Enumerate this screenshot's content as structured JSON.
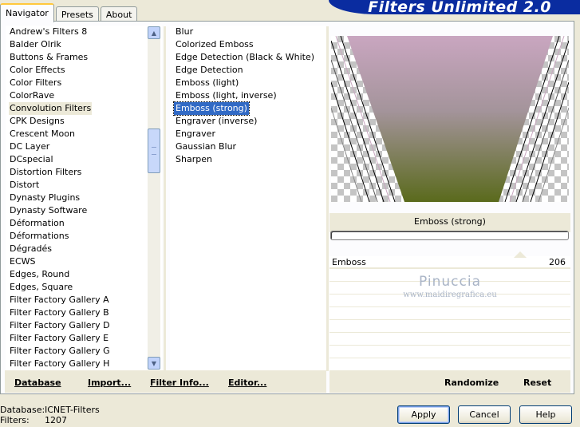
{
  "tabs": [
    "Navigator",
    "Presets",
    "About"
  ],
  "banner_title": "Filters Unlimited 2.0",
  "categories": [
    "Andrew's Filters 8",
    "Balder Olrik",
    "Buttons & Frames",
    "Color Effects",
    "Color Filters",
    "ColorRave",
    "Convolution Filters",
    "CPK Designs",
    "Crescent Moon",
    "DC Layer",
    "DCspecial",
    "Distortion Filters",
    "Distort",
    "Dynasty Plugins",
    "Dynasty Software",
    "Déformation",
    "Déformations",
    "Dégradés",
    "ECWS",
    "Edges, Round",
    "Edges, Square",
    "Filter Factory Gallery A",
    "Filter Factory Gallery B",
    "Filter Factory Gallery D",
    "Filter Factory Gallery E",
    "Filter Factory Gallery G",
    "Filter Factory Gallery H"
  ],
  "selected_category": "Convolution Filters",
  "filters": [
    "Blur",
    "Colorized Emboss",
    "Edge Detection (Black & White)",
    "Edge Detection",
    "Emboss (light)",
    "Emboss (light, inverse)",
    "Emboss (strong)",
    "Engraver (inverse)",
    "Engraver",
    "Gaussian Blur",
    "Sharpen"
  ],
  "selected_filter": "Emboss (strong)",
  "param": {
    "label": "Emboss",
    "value": "206",
    "fraction": 0.808
  },
  "watermark": {
    "name": "Pinuccia",
    "url": "www.maidiregrafica.eu"
  },
  "toolbar": {
    "database": "Database",
    "import": "Import...",
    "filter_info": "Filter Info...",
    "editor": "Editor...",
    "randomize": "Randomize",
    "reset": "Reset"
  },
  "status": {
    "database_label": "Database:",
    "database_value": "ICNET-Filters",
    "filters_label": "Filters:",
    "filters_value": "1207"
  },
  "buttons": {
    "apply": "Apply",
    "cancel": "Cancel",
    "help": "Help"
  },
  "colors": {
    "banner": "#0a2ca0",
    "selection": "#316ac5",
    "preview_top": "#c9a6c0",
    "preview_bottom": "#5a6a1c"
  }
}
